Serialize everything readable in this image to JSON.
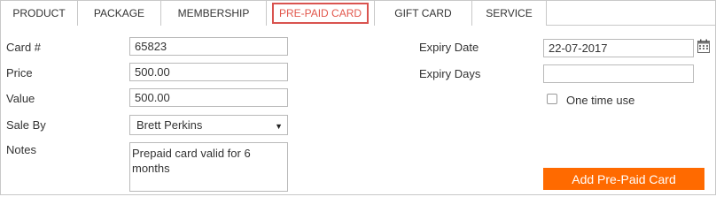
{
  "tabs": [
    {
      "label": "PRODUCT"
    },
    {
      "label": "PACKAGE"
    },
    {
      "label": "MEMBERSHIP"
    },
    {
      "label": "PRE-PAID CARD",
      "active": true
    },
    {
      "label": "GIFT CARD"
    },
    {
      "label": "SERVICE"
    }
  ],
  "form": {
    "card_number": {
      "label": "Card #",
      "value": "65823"
    },
    "price": {
      "label": "Price",
      "value": "500.00"
    },
    "value": {
      "label": "Value",
      "value": "500.00"
    },
    "sale_by": {
      "label": "Sale By",
      "value": "Brett Perkins"
    },
    "notes": {
      "label": "Notes",
      "value": "Prepaid card valid for 6 months"
    },
    "expiry_date": {
      "label": "Expiry Date",
      "value": "22-07-2017"
    },
    "expiry_days": {
      "label": "Expiry Days",
      "value": ""
    },
    "one_time_use": {
      "label": "One time use",
      "checked": false
    }
  },
  "actions": {
    "add_label": "Add Pre-Paid Card"
  },
  "colors": {
    "accent": "#ff6a00",
    "active_tab": "#e2574c"
  },
  "icons": {
    "calendar": "calendar-icon",
    "dropdown": "chevron-down-icon"
  }
}
